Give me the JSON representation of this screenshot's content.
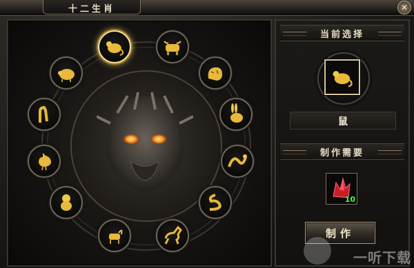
{
  "window": {
    "title": "十二生肖",
    "close_label": "✕"
  },
  "zodiac": [
    {
      "key": "rat",
      "icon": "rat-icon",
      "selected": true
    },
    {
      "key": "ox",
      "icon": "ox-icon",
      "selected": false
    },
    {
      "key": "tiger",
      "icon": "tiger-icon",
      "selected": false
    },
    {
      "key": "rabbit",
      "icon": "rabbit-icon",
      "selected": false
    },
    {
      "key": "dragon",
      "icon": "dragon-icon",
      "selected": false
    },
    {
      "key": "snake",
      "icon": "snake-icon",
      "selected": false
    },
    {
      "key": "horse",
      "icon": "horse-icon",
      "selected": false
    },
    {
      "key": "goat",
      "icon": "goat-icon",
      "selected": false
    },
    {
      "key": "monkey",
      "icon": "monkey-icon",
      "selected": false
    },
    {
      "key": "rooster",
      "icon": "rooster-icon",
      "selected": false
    },
    {
      "key": "dog",
      "icon": "dog-icon",
      "selected": false
    },
    {
      "key": "pig",
      "icon": "pig-icon",
      "selected": false
    }
  ],
  "right": {
    "current_header": "当前选择",
    "selected_name": "鼠",
    "requirements_header": "制作需要",
    "requirement": {
      "icon": "red-crystal-icon",
      "count": "10"
    },
    "make_button": "制作"
  },
  "watermark": "一听下载",
  "colors": {
    "gold": "#e8b93a",
    "accent": "#f4e2a1",
    "count": "#43ff3a"
  }
}
